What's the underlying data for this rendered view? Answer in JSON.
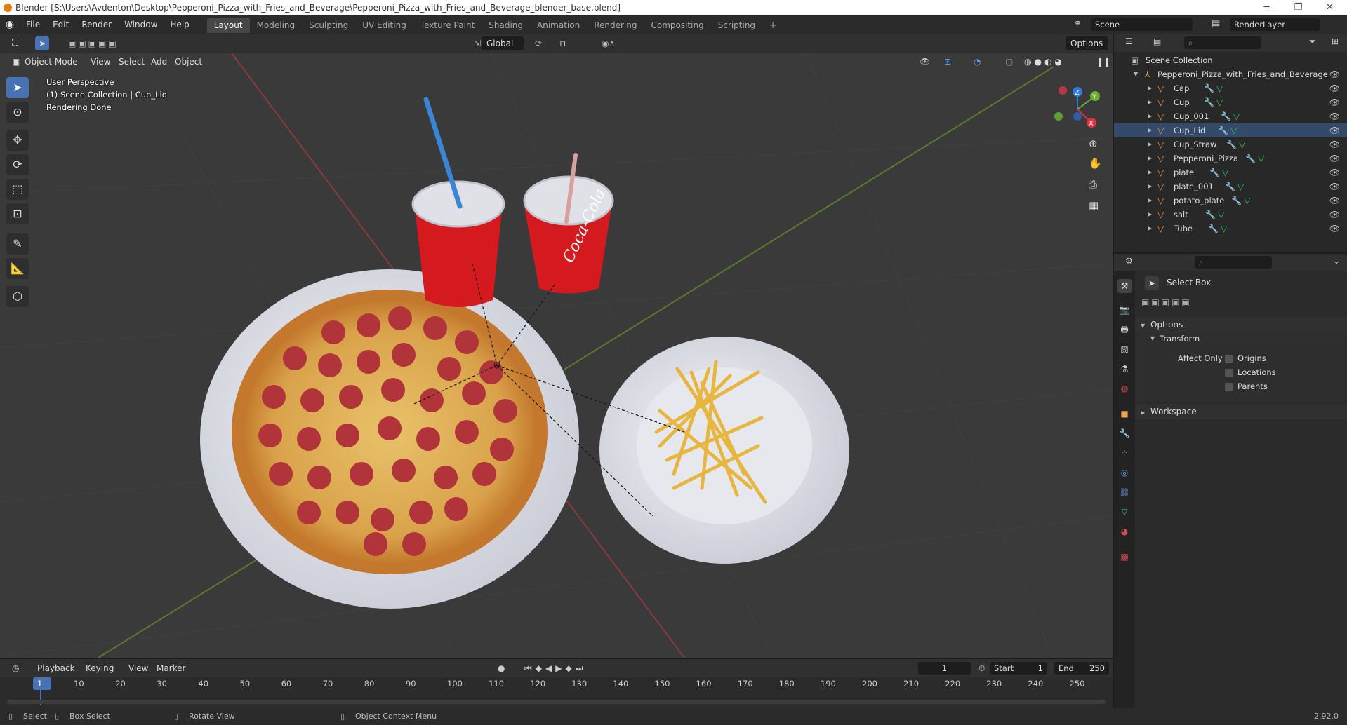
{
  "window": {
    "title": "Blender [S:\\Users\\Avdenton\\Desktop\\Pepperoni_Pizza_with_Fries_and_Beverage\\Pepperoni_Pizza_with_Fries_and_Beverage_blender_base.blend]",
    "minimize": "─",
    "maximize": "❐",
    "close": "✕"
  },
  "menu": {
    "items": [
      "File",
      "Edit",
      "Render",
      "Window",
      "Help"
    ],
    "tabs": [
      "Layout",
      "Modeling",
      "Sculpting",
      "UV Editing",
      "Texture Paint",
      "Shading",
      "Animation",
      "Rendering",
      "Compositing",
      "Scripting"
    ],
    "add_tab": "+",
    "scene": "Scene",
    "render_layer": "RenderLayer"
  },
  "viewport_header": {
    "mode": "Object Mode",
    "menus": [
      "View",
      "Select",
      "Add",
      "Object"
    ],
    "orientation": "Global",
    "options": "Options"
  },
  "viewport_overlay": {
    "line1": "User Perspective",
    "line2": "(1) Scene Collection | Cup_Lid",
    "line3": "Rendering Done"
  },
  "gizmo": {
    "z": "Z",
    "y": "Y",
    "x": "X"
  },
  "outliner": {
    "root": "Scene Collection",
    "collection": "Pepperoni_Pizza_with_Fries_and_Beverage",
    "objects": [
      "Cap",
      "Cup",
      "Cup_001",
      "Cup_Lid",
      "Cup_Straw",
      "Pepperoni_Pizza",
      "plate",
      "plate_001",
      "potato_plate",
      "salt",
      "Tube"
    ],
    "selected": "Cup_Lid"
  },
  "properties": {
    "tool_name": "Select Box",
    "options": "Options",
    "transform": "Transform",
    "affect_only": "Affect Only",
    "checks": [
      "Origins",
      "Locations",
      "Parents"
    ],
    "workspace": "Workspace"
  },
  "timeline": {
    "menus": [
      "Playback",
      "Keying",
      "View",
      "Marker"
    ],
    "current_frame": "1",
    "start_label": "Start",
    "start": "1",
    "end_label": "End",
    "end": "250",
    "ticks": [
      "1",
      "10",
      "20",
      "30",
      "40",
      "50",
      "60",
      "70",
      "80",
      "90",
      "100",
      "110",
      "120",
      "130",
      "140",
      "150",
      "160",
      "170",
      "180",
      "190",
      "200",
      "210",
      "220",
      "230",
      "240",
      "250"
    ]
  },
  "status": {
    "select": "Select",
    "box_select": "Box Select",
    "rotate": "Rotate View",
    "context": "Object Context Menu",
    "version": "2.92.0"
  },
  "colors": {
    "accent": "#4772b3",
    "object": "#e8a65a",
    "mesh": "#3ec46d",
    "modifier": "#6aa3e8"
  }
}
